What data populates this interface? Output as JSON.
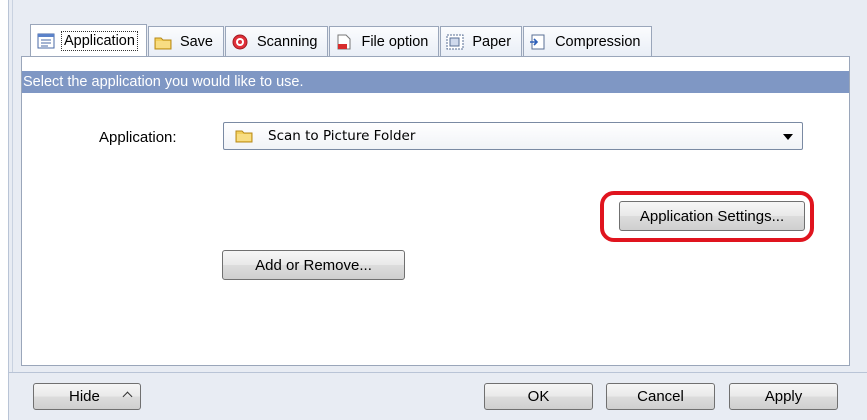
{
  "tabs": [
    {
      "label": "Application",
      "icon": "application-icon",
      "active": true
    },
    {
      "label": "Save",
      "icon": "folder-icon",
      "active": false
    },
    {
      "label": "Scanning",
      "icon": "scanning-icon",
      "active": false
    },
    {
      "label": "File option",
      "icon": "file-option-icon",
      "active": false
    },
    {
      "label": "Paper",
      "icon": "paper-icon",
      "active": false
    },
    {
      "label": "Compression",
      "icon": "compression-icon",
      "active": false
    }
  ],
  "panel": {
    "banner_text": "Select the application you would like to use.",
    "application_label": "Application:",
    "application_value": "Scan to Picture Folder",
    "app_settings_label": "Application Settings...",
    "add_remove_label": "Add or Remove..."
  },
  "footer": {
    "hide_label": "Hide",
    "ok_label": "OK",
    "cancel_label": "Cancel",
    "apply_label": "Apply"
  },
  "colors": {
    "banner": "#7f97c4",
    "highlight": "#e0141e",
    "frame": "#e8ecf3"
  }
}
